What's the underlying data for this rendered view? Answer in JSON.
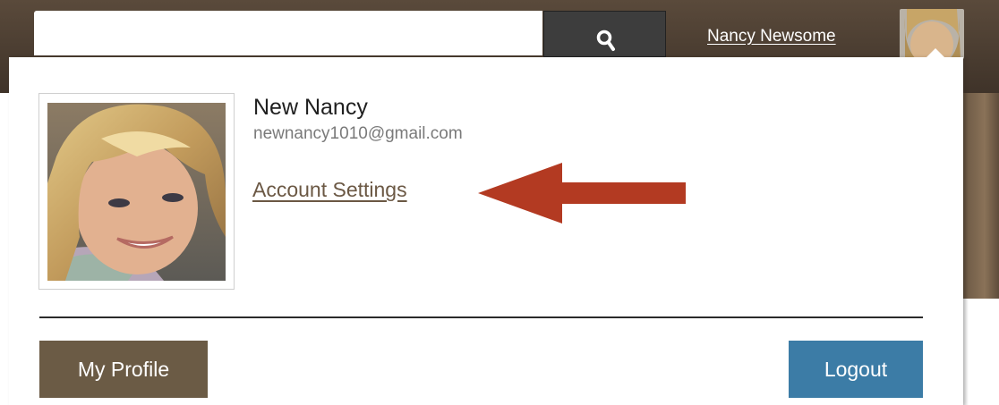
{
  "header": {
    "search": {
      "value": "",
      "placeholder": ""
    },
    "search_button_icon": "search-icon",
    "user_name": "Nancy Newsome"
  },
  "dropdown": {
    "display_name": "New Nancy",
    "email": "newnancy1010@gmail.com",
    "account_settings_label": "Account Settings",
    "my_profile_label": "My Profile",
    "logout_label": "Logout"
  },
  "colors": {
    "header_brown": "#4a3c30",
    "profile_button": "#6b5b45",
    "logout_button": "#3c7ca6",
    "link": "#6b5844",
    "annotation_arrow": "#b33a22"
  }
}
